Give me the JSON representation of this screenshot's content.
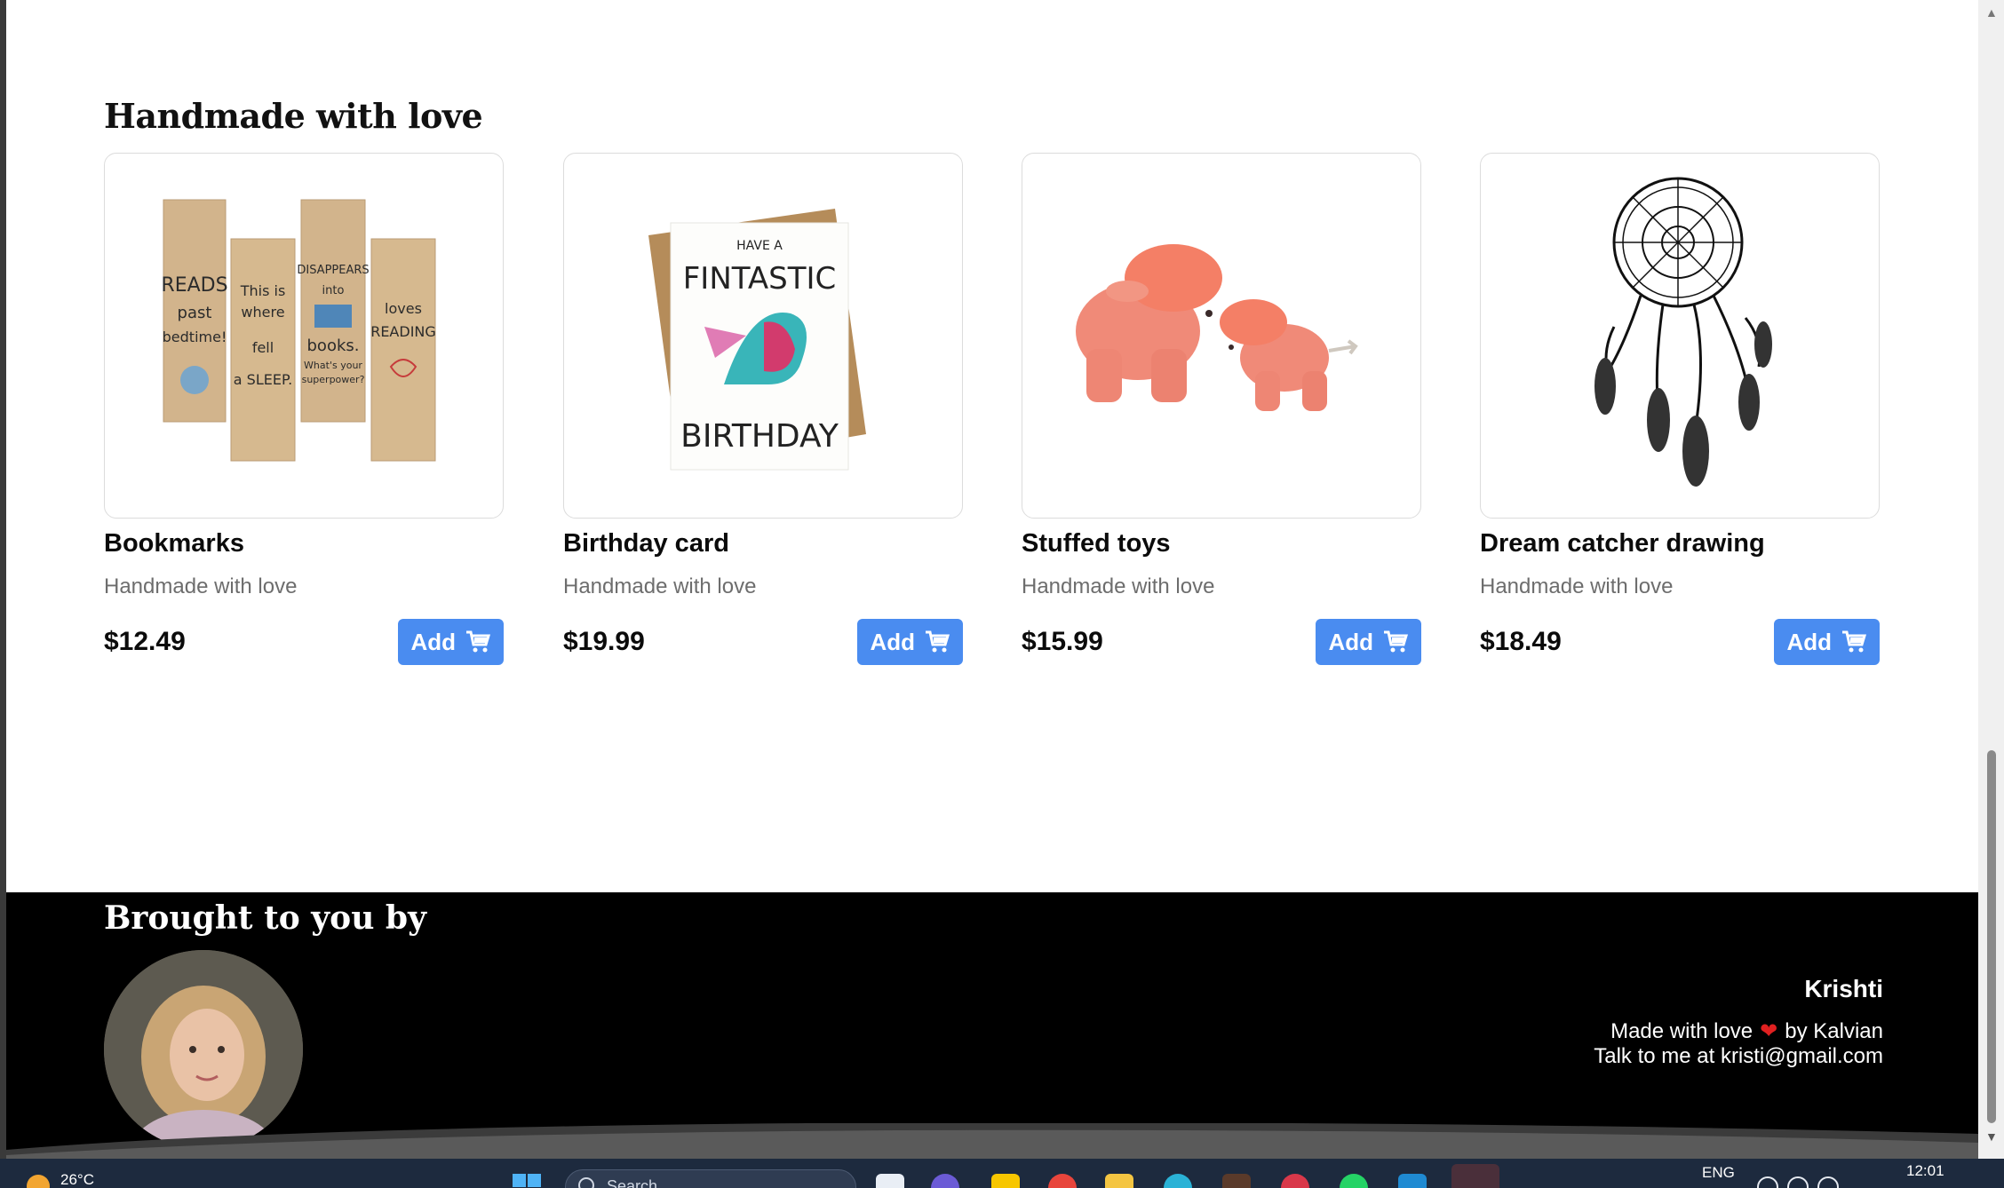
{
  "section": {
    "title": "Handmade with love"
  },
  "products": [
    {
      "title": "Bookmarks",
      "subtitle": "Handmade with love",
      "price": "$12.49",
      "button": "Add"
    },
    {
      "title": "Birthday card",
      "subtitle": "Handmade with love",
      "price": "$19.99",
      "button": "Add"
    },
    {
      "title": "Stuffed toys",
      "subtitle": "Handmade with love",
      "price": "$15.99",
      "button": "Add"
    },
    {
      "title": "Dream catcher drawing",
      "subtitle": "Handmade with love",
      "price": "$18.49",
      "button": "Add"
    }
  ],
  "images": {
    "bookmarks": [
      "READS",
      "past",
      "bedtime!",
      "This is",
      "where",
      "fell",
      "a SLEEP.",
      "DISAPPEARS",
      "into",
      "books.",
      "What's your",
      "superpower?",
      "loves",
      "READING"
    ],
    "card": [
      "HAVE A",
      "FINTASTIC",
      "BIRTHDAY"
    ]
  },
  "footer": {
    "title": "Brought to you by",
    "name": "Krishti",
    "line1_prefix": "Made with love",
    "heart": "❤",
    "line1_suffix": "by Kalvian",
    "line2": "Talk to me at kristi@gmail.com"
  },
  "taskbar": {
    "temperature": "26°C",
    "search": "Search",
    "language": "ENG",
    "time": "12:01"
  },
  "colors": {
    "accent": "#4a8cf0",
    "footer_bg": "#000000",
    "taskbar_bg": "#1d2a3e"
  }
}
